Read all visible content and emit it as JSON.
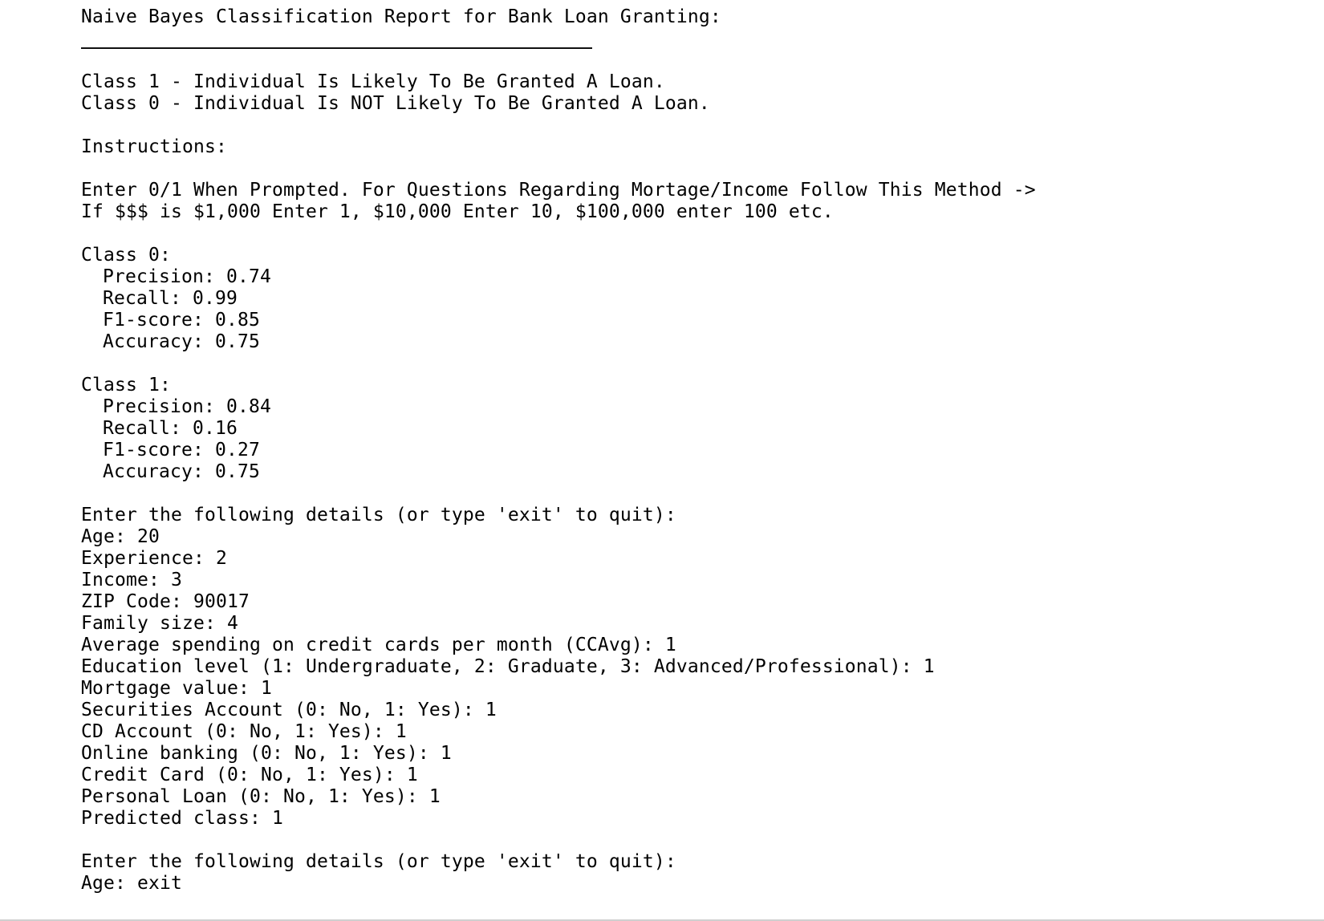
{
  "terminal": {
    "title": "Naive Bayes Classification Report for Bank Loan Granting:",
    "class_descriptions": [
      "Class 1 - Individual Is Likely To Be Granted A Loan.",
      "Class 0 - Individual Is NOT Likely To Be Granted A Loan."
    ],
    "instructions_heading": "Instructions:",
    "instructions": [
      "Enter 0/1 When Prompted. For Questions Regarding Mortage/Income Follow This Method ->",
      "If $$$ is $1,000 Enter 1, $10,000 Enter 10, $100,000 enter 100 etc."
    ],
    "classes": [
      {
        "heading": "Class 0:",
        "metrics": [
          "Precision: 0.74",
          "Recall: 0.99",
          "F1-score: 0.85",
          "Accuracy: 0.75"
        ]
      },
      {
        "heading": "Class 1:",
        "metrics": [
          "Precision: 0.84",
          "Recall: 0.16",
          "F1-score: 0.27",
          "Accuracy: 0.75"
        ]
      }
    ],
    "session_1": {
      "prompt": "Enter the following details (or type 'exit' to quit):",
      "inputs": [
        "Age: 20",
        "Experience: 2",
        "Income: 3",
        "ZIP Code: 90017",
        "Family size: 4",
        "Average spending on credit cards per month (CCAvg): 1",
        "Education level (1: Undergraduate, 2: Graduate, 3: Advanced/Professional): 1",
        "Mortgage value: 1",
        "Securities Account (0: No, 1: Yes): 1",
        "CD Account (0: No, 1: Yes): 1",
        "Online banking (0: No, 1: Yes): 1",
        "Credit Card (0: No, 1: Yes): 1",
        "Personal Loan (0: No, 1: Yes): 1"
      ],
      "result": "Predicted class: 1"
    },
    "session_2": {
      "prompt": "Enter the following details (or type 'exit' to quit):",
      "inputs": [
        "Age: exit"
      ]
    }
  }
}
